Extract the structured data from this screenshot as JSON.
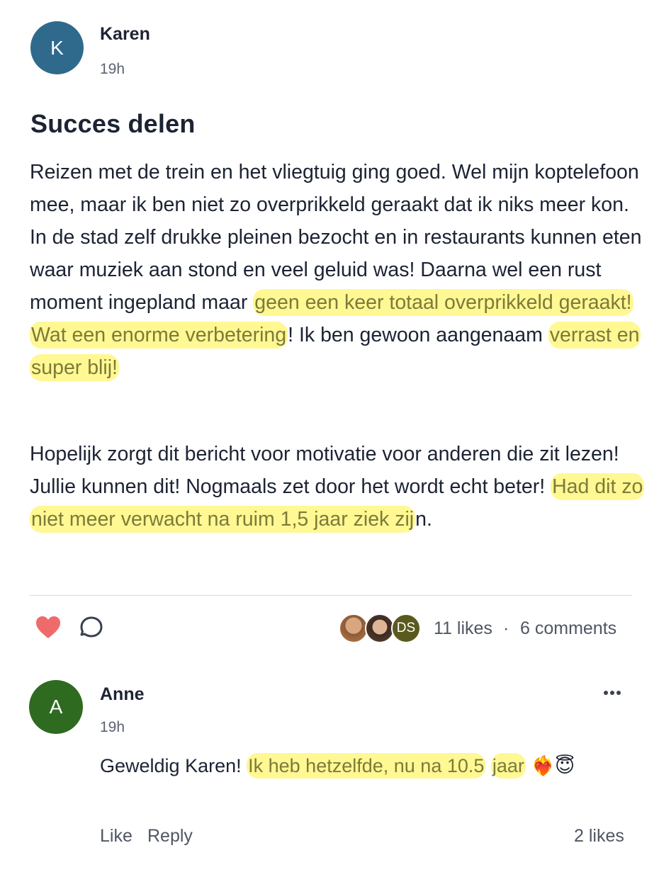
{
  "post": {
    "author": {
      "initial": "K",
      "name": "Karen",
      "time": "19h",
      "avatar_color": "#2f6a8c"
    },
    "title": "Succes delen",
    "paragraph1": {
      "plain_1": "Reizen met de trein en het vliegtuig ging goed. Wel mijn koptelefoon mee, maar ik ben niet zo overprikkeld geraakt dat ik niks meer kon. In de stad zelf drukke pleinen bezocht en in restaurants kunnen eten waar muziek aan stond en veel geluid was! Daarna wel een rust moment ingepland maar ",
      "highlight_1": "geen een keer totaal overprikkeld geraakt! Wat een enorme verbetering",
      "plain_2": "! Ik ben gewoon aangenaam ",
      "highlight_2": "verrast en super blij!"
    },
    "paragraph2": {
      "plain_1": "Hopelijk zorgt dit bericht voor motivatie voor anderen die zit lezen! Jullie kunnen dit! Nogmaals zet door het wordt echt beter! ",
      "highlight_1": "Had dit zo niet meer verwacht na ruim 1,5 jaar ziek zij",
      "plain_2": "n."
    },
    "stats": {
      "likes": "11 likes",
      "separator": "·",
      "comments": "6 comments",
      "liker_initials": "DS"
    },
    "colors": {
      "heart": "#ef6b6b",
      "highlight": "#fff450",
      "liker_ds": "#5a5a1e"
    }
  },
  "comment": {
    "author": {
      "initial": "A",
      "name": "Anne",
      "time": "19h",
      "avatar_color": "#2e6a1f"
    },
    "more_icon": "more-horizontal-icon",
    "text_plain": "Geweldig Karen! ",
    "text_highlight_1": "Ik heb hetzelfde, nu na 10.5",
    "text_space": " ",
    "text_highlight_2": "jaar",
    "emoji": " ❤️‍🔥😇",
    "like_label": "Like",
    "reply_label": "Reply",
    "likes": "2 likes"
  },
  "icons": {
    "like": "heart-icon",
    "comment": "comment-bubble-icon"
  }
}
